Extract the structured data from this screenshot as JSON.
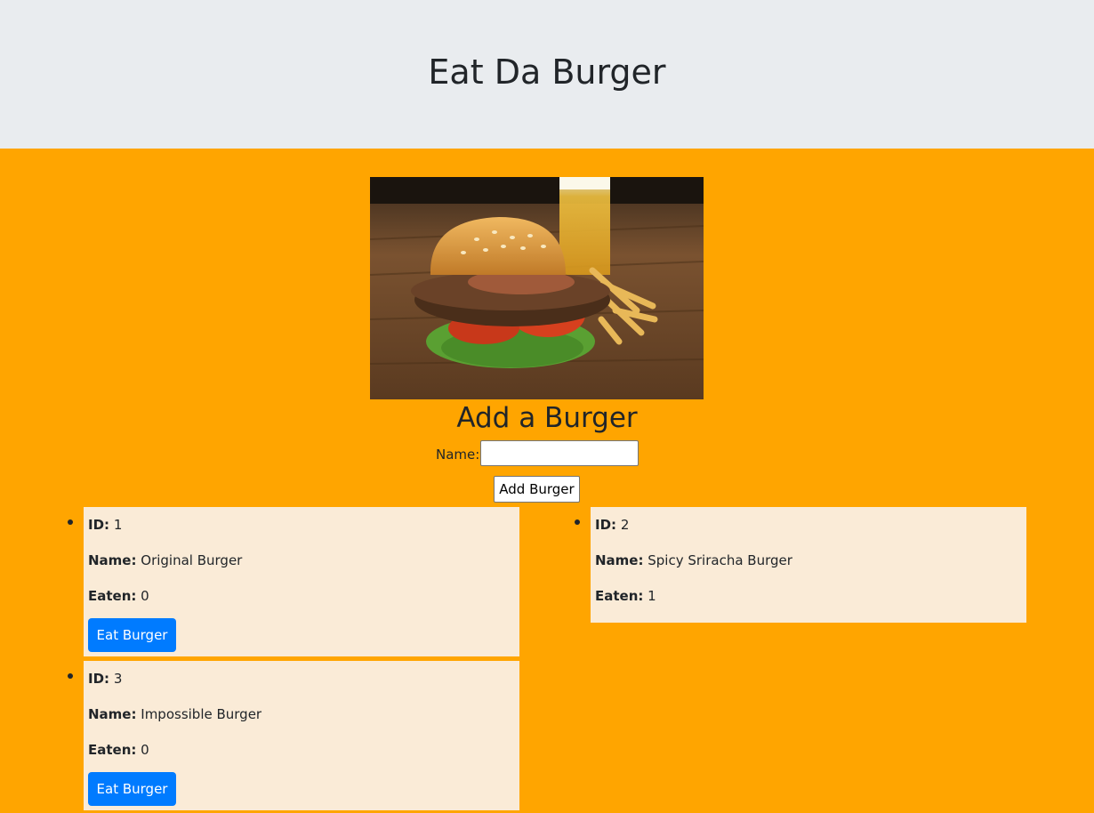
{
  "header": {
    "title": "Eat Da Burger"
  },
  "form": {
    "title": "Add a Burger",
    "name_label": "Name:",
    "name_value": "",
    "submit_label": "Add Burger"
  },
  "labels": {
    "id": "ID:",
    "name": "Name:",
    "eaten": "Eaten:"
  },
  "burgers": [
    {
      "id": "1",
      "name": "Original Burger",
      "eaten": "0",
      "button": "Eat Burger"
    },
    {
      "id": "2",
      "name": "Spicy Sriracha Burger",
      "eaten": "1"
    },
    {
      "id": "3",
      "name": "Impossible Burger",
      "eaten": "0",
      "button": "Eat Burger"
    }
  ],
  "colors": {
    "header_bg": "#e9ecef",
    "page_bg": "#ffa500",
    "card_bg": "#faebd7",
    "button_primary": "#007bff"
  },
  "image": {
    "subject": "burger-with-fries-and-beer-photo"
  }
}
